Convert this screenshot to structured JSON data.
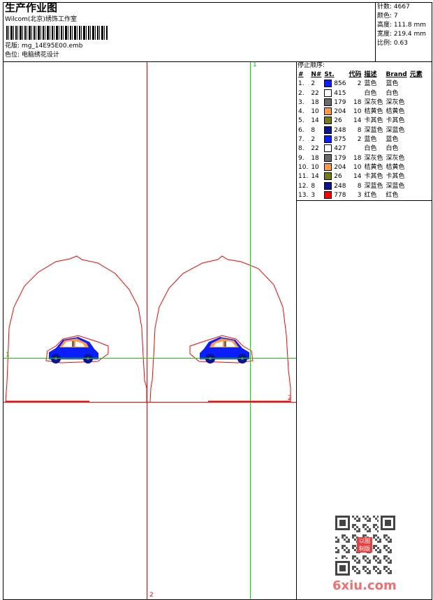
{
  "header": {
    "title": "生产作业图",
    "company": "Wilcom(北京)绣饰工作室",
    "design_label": "花版:",
    "design_value": "mg_14E95E00.emb",
    "colorway_label": "色位:",
    "colorway_value": "电脑绣花设计"
  },
  "info": {
    "stitches": "针数: 4667",
    "colors": "颜色: 7",
    "height": "高度: 111.8 mm",
    "width": "宽度: 219.4 mm",
    "scale": "比例: 0.63"
  },
  "sequence": {
    "title": "停止顺序:",
    "columns": [
      "#",
      "N#",
      "St.",
      "代码",
      "描述",
      "Brand",
      "元素"
    ],
    "rows": [
      {
        "idx": "1.",
        "n": "2",
        "color": "#0a1eff",
        "st": "856",
        "code": "2",
        "desc": "蓝色",
        "brand": "蓝色"
      },
      {
        "idx": "2.",
        "n": "22",
        "color": "#ffffff",
        "st": "415",
        "code": "",
        "desc": "白色",
        "brand": "白色"
      },
      {
        "idx": "3.",
        "n": "18",
        "color": "#6b6b6b",
        "st": "179",
        "code": "18",
        "desc": "深灰色",
        "brand": "深灰色"
      },
      {
        "idx": "4.",
        "n": "10",
        "color": "#ff9a40",
        "st": "204",
        "code": "10",
        "desc": "桔黄色",
        "brand": "桔黄色"
      },
      {
        "idx": "5.",
        "n": "14",
        "color": "#7a7a10",
        "st": "26",
        "code": "14",
        "desc": "卡其色",
        "brand": "卡其色"
      },
      {
        "idx": "6.",
        "n": "8",
        "color": "#0a1496",
        "st": "248",
        "code": "8",
        "desc": "深蓝色",
        "brand": "深蓝色"
      },
      {
        "idx": "7.",
        "n": "2",
        "color": "#0a1eff",
        "st": "875",
        "code": "2",
        "desc": "蓝色",
        "brand": "蓝色"
      },
      {
        "idx": "8.",
        "n": "22",
        "color": "#ffffff",
        "st": "427",
        "code": "",
        "desc": "白色",
        "brand": "白色"
      },
      {
        "idx": "9.",
        "n": "18",
        "color": "#6b6b6b",
        "st": "179",
        "code": "18",
        "desc": "深灰色",
        "brand": "深灰色"
      },
      {
        "idx": "10.",
        "n": "10",
        "color": "#ff9a40",
        "st": "204",
        "code": "10",
        "desc": "桔黄色",
        "brand": "桔黄色"
      },
      {
        "idx": "11.",
        "n": "14",
        "color": "#7a7a10",
        "st": "26",
        "code": "14",
        "desc": "卡其色",
        "brand": "卡其色"
      },
      {
        "idx": "12.",
        "n": "8",
        "color": "#0a1496",
        "st": "248",
        "code": "8",
        "desc": "深蓝色",
        "brand": "深蓝色"
      },
      {
        "idx": "13.",
        "n": "3",
        "color": "#ff0000",
        "st": "778",
        "code": "3",
        "desc": "红色",
        "brand": "红色"
      }
    ]
  },
  "canvas": {
    "marker_1": "1",
    "marker_2": "2",
    "guide_green": "#00e000",
    "guide_red": "#ff0000"
  },
  "watermark": {
    "text": "6xiu.com",
    "seal": "以图制版"
  }
}
